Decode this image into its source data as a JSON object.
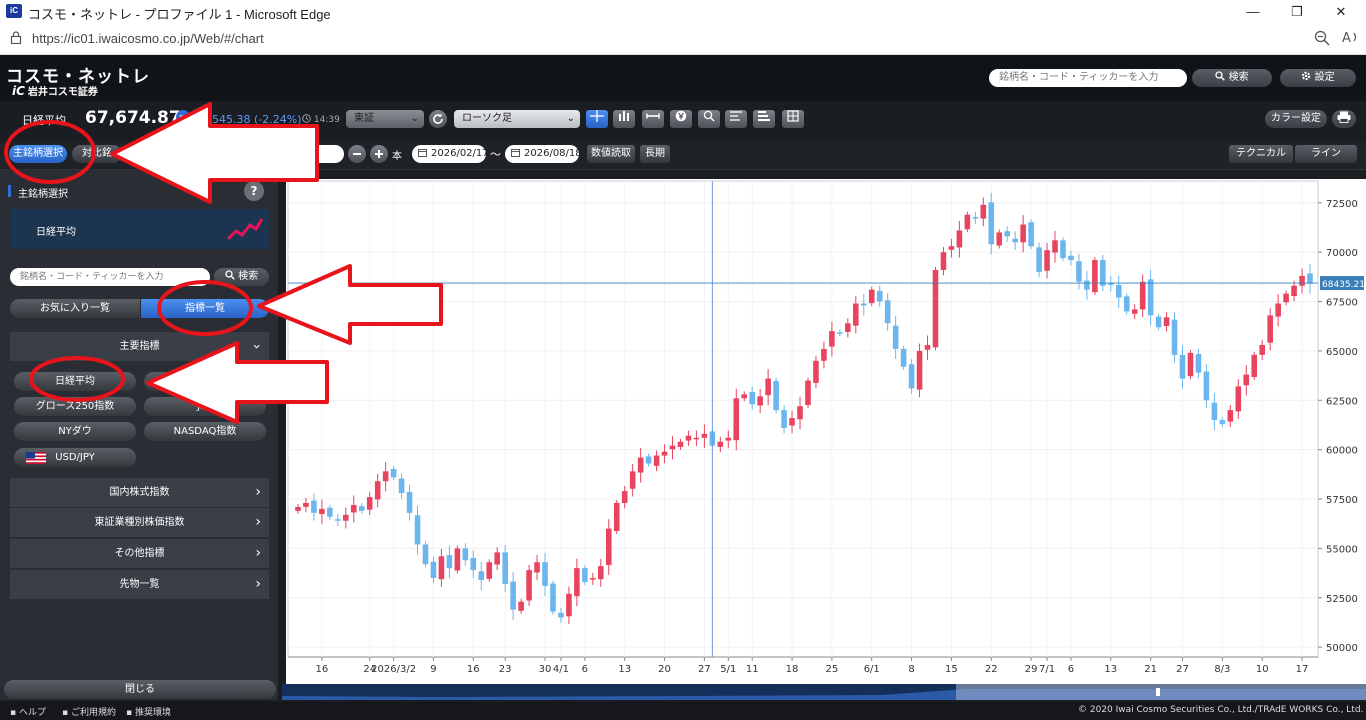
{
  "window": {
    "title": "コスモ・ネットレ - プロファイル 1 - Microsoft Edge",
    "logo_text": "iC",
    "minimize": "—",
    "maximize": "❐",
    "close": "✕",
    "url": "https://ic01.iwaicosmo.co.jp/Web/#/chart"
  },
  "header": {
    "brand": "コスモ・ネットレ",
    "brand_sub_logo": "iC",
    "brand_sub": "岩井コスモ証券",
    "search_placeholder": "銘柄名・コード・ティッカーを入力",
    "search_button": "検索",
    "settings_button": "設定"
  },
  "index": {
    "name": "日経平均",
    "value": "67,674.87",
    "change": "545.38 (-2.24%)",
    "time": "14:39",
    "market_select": "東証",
    "chart_type_select": "ローソク足",
    "color_button": "カラー設定"
  },
  "controls": {
    "tab_main": "主銘柄選択",
    "tab_compare": "対比銘",
    "count_value": "3",
    "count_unit": "本",
    "date_from": "2026/02/17",
    "range_sep": "〜",
    "date_to": "2026/08/18",
    "btn_numeric": "数値読取",
    "btn_long": "長期",
    "btn_technical": "テクニカル",
    "btn_line": "ライン"
  },
  "sidebar": {
    "section_title": "主銘柄選択",
    "help": "?",
    "selected_name": "日経平均",
    "search_placeholder": "銘柄名・コード・ティッカーを入力",
    "search_button": "検索",
    "tab_favorites": "お気に入り一覧",
    "tab_index_list": "指標一覧",
    "group_title": "主要指標",
    "buttons": [
      "日経平均",
      "",
      "グロース250指数",
      "JPX",
      "NYダウ",
      "NASDAQ指数",
      "USD/JPY"
    ],
    "nav": [
      "国内株式指数",
      "東証業種別株価指数",
      "その他指標",
      "先物一覧"
    ],
    "close": "閉じる"
  },
  "footer": {
    "help": "ヘルプ",
    "terms": "ご利用規約",
    "env": "推奨環境",
    "copyright": "© 2020 Iwai Cosmo Securities Co., Ltd./TRAdE WORKS Co., Ltd."
  },
  "colors": {
    "up": "#e8445f",
    "down": "#6bb6ee",
    "accent": "#2f6fd6",
    "annotation": "#e8141c"
  },
  "chart_data": {
    "type": "candlestick",
    "current_price_label": "68435.21",
    "current_price": 68435.21,
    "ylim": [
      49500,
      73300
    ],
    "y_ticks": [
      {
        "value": 72500,
        "label": "72500"
      },
      {
        "value": 70000,
        "label": "70000"
      },
      {
        "value": 67500,
        "label": "67500"
      },
      {
        "value": 65000,
        "label": "65000"
      },
      {
        "value": 62500,
        "label": "62500"
      },
      {
        "value": 60000,
        "label": "60000"
      },
      {
        "value": 57500,
        "label": "57500"
      },
      {
        "value": 55000,
        "label": "55000"
      },
      {
        "value": 52500,
        "label": "52500"
      },
      {
        "value": 50000,
        "label": "50000"
      }
    ],
    "x_ticks": [
      {
        "index": 3,
        "label": "16"
      },
      {
        "index": 9,
        "label": "24"
      },
      {
        "index": 12,
        "label": "2026/3/2"
      },
      {
        "index": 17,
        "label": "9"
      },
      {
        "index": 22,
        "label": "16"
      },
      {
        "index": 26,
        "label": "23"
      },
      {
        "index": 31,
        "label": "30"
      },
      {
        "index": 33,
        "label": "4/1"
      },
      {
        "index": 36,
        "label": "6"
      },
      {
        "index": 41,
        "label": "13"
      },
      {
        "index": 46,
        "label": "20"
      },
      {
        "index": 51,
        "label": "27"
      },
      {
        "index": 54,
        "label": "5/1"
      },
      {
        "index": 57,
        "label": "11"
      },
      {
        "index": 62,
        "label": "18"
      },
      {
        "index": 67,
        "label": "25"
      },
      {
        "index": 72,
        "label": "6/1"
      },
      {
        "index": 77,
        "label": "8"
      },
      {
        "index": 82,
        "label": "15"
      },
      {
        "index": 87,
        "label": "22"
      },
      {
        "index": 92,
        "label": "29"
      },
      {
        "index": 94,
        "label": "7/1"
      },
      {
        "index": 97,
        "label": "6"
      },
      {
        "index": 102,
        "label": "13"
      },
      {
        "index": 107,
        "label": "21"
      },
      {
        "index": 111,
        "label": "27"
      },
      {
        "index": 116,
        "label": "8/3"
      },
      {
        "index": 121,
        "label": "10"
      },
      {
        "index": 126,
        "label": "17"
      }
    ],
    "crosshair_index": 52,
    "closes": [
      57100,
      57300,
      56800,
      57000,
      56600,
      56400,
      56700,
      57200,
      56900,
      57600,
      58400,
      58900,
      58600,
      57800,
      56800,
      55200,
      54200,
      53500,
      54600,
      54000,
      55000,
      54400,
      53900,
      53400,
      54300,
      54800,
      53200,
      51900,
      52300,
      53900,
      54300,
      53100,
      51800,
      51500,
      52700,
      54000,
      53300,
      53500,
      54100,
      56000,
      57300,
      57900,
      58900,
      59600,
      59300,
      59700,
      59900,
      60200,
      60400,
      60700,
      60600,
      60800,
      60200,
      60400,
      60600,
      62600,
      62800,
      62300,
      62700,
      63600,
      62000,
      61100,
      61600,
      62200,
      63500,
      64500,
      65100,
      66000,
      65900,
      66400,
      67400,
      67300,
      68100,
      67500,
      66400,
      65100,
      64200,
      63100,
      65000,
      65300,
      69100,
      70000,
      70300,
      71100,
      71900,
      71700,
      72400,
      70400,
      71000,
      70800,
      70500,
      71400,
      70300,
      69000,
      70100,
      70600,
      69700,
      69600,
      68500,
      68100,
      69600,
      68300,
      68400,
      67700,
      67000,
      67100,
      68500,
      66800,
      66200,
      66700,
      64800,
      63600,
      64900,
      63900,
      62500,
      61500,
      61300,
      62000,
      63200,
      63800,
      64800,
      65300,
      66800,
      67400,
      67900,
      68300,
      68800,
      68400
    ]
  }
}
